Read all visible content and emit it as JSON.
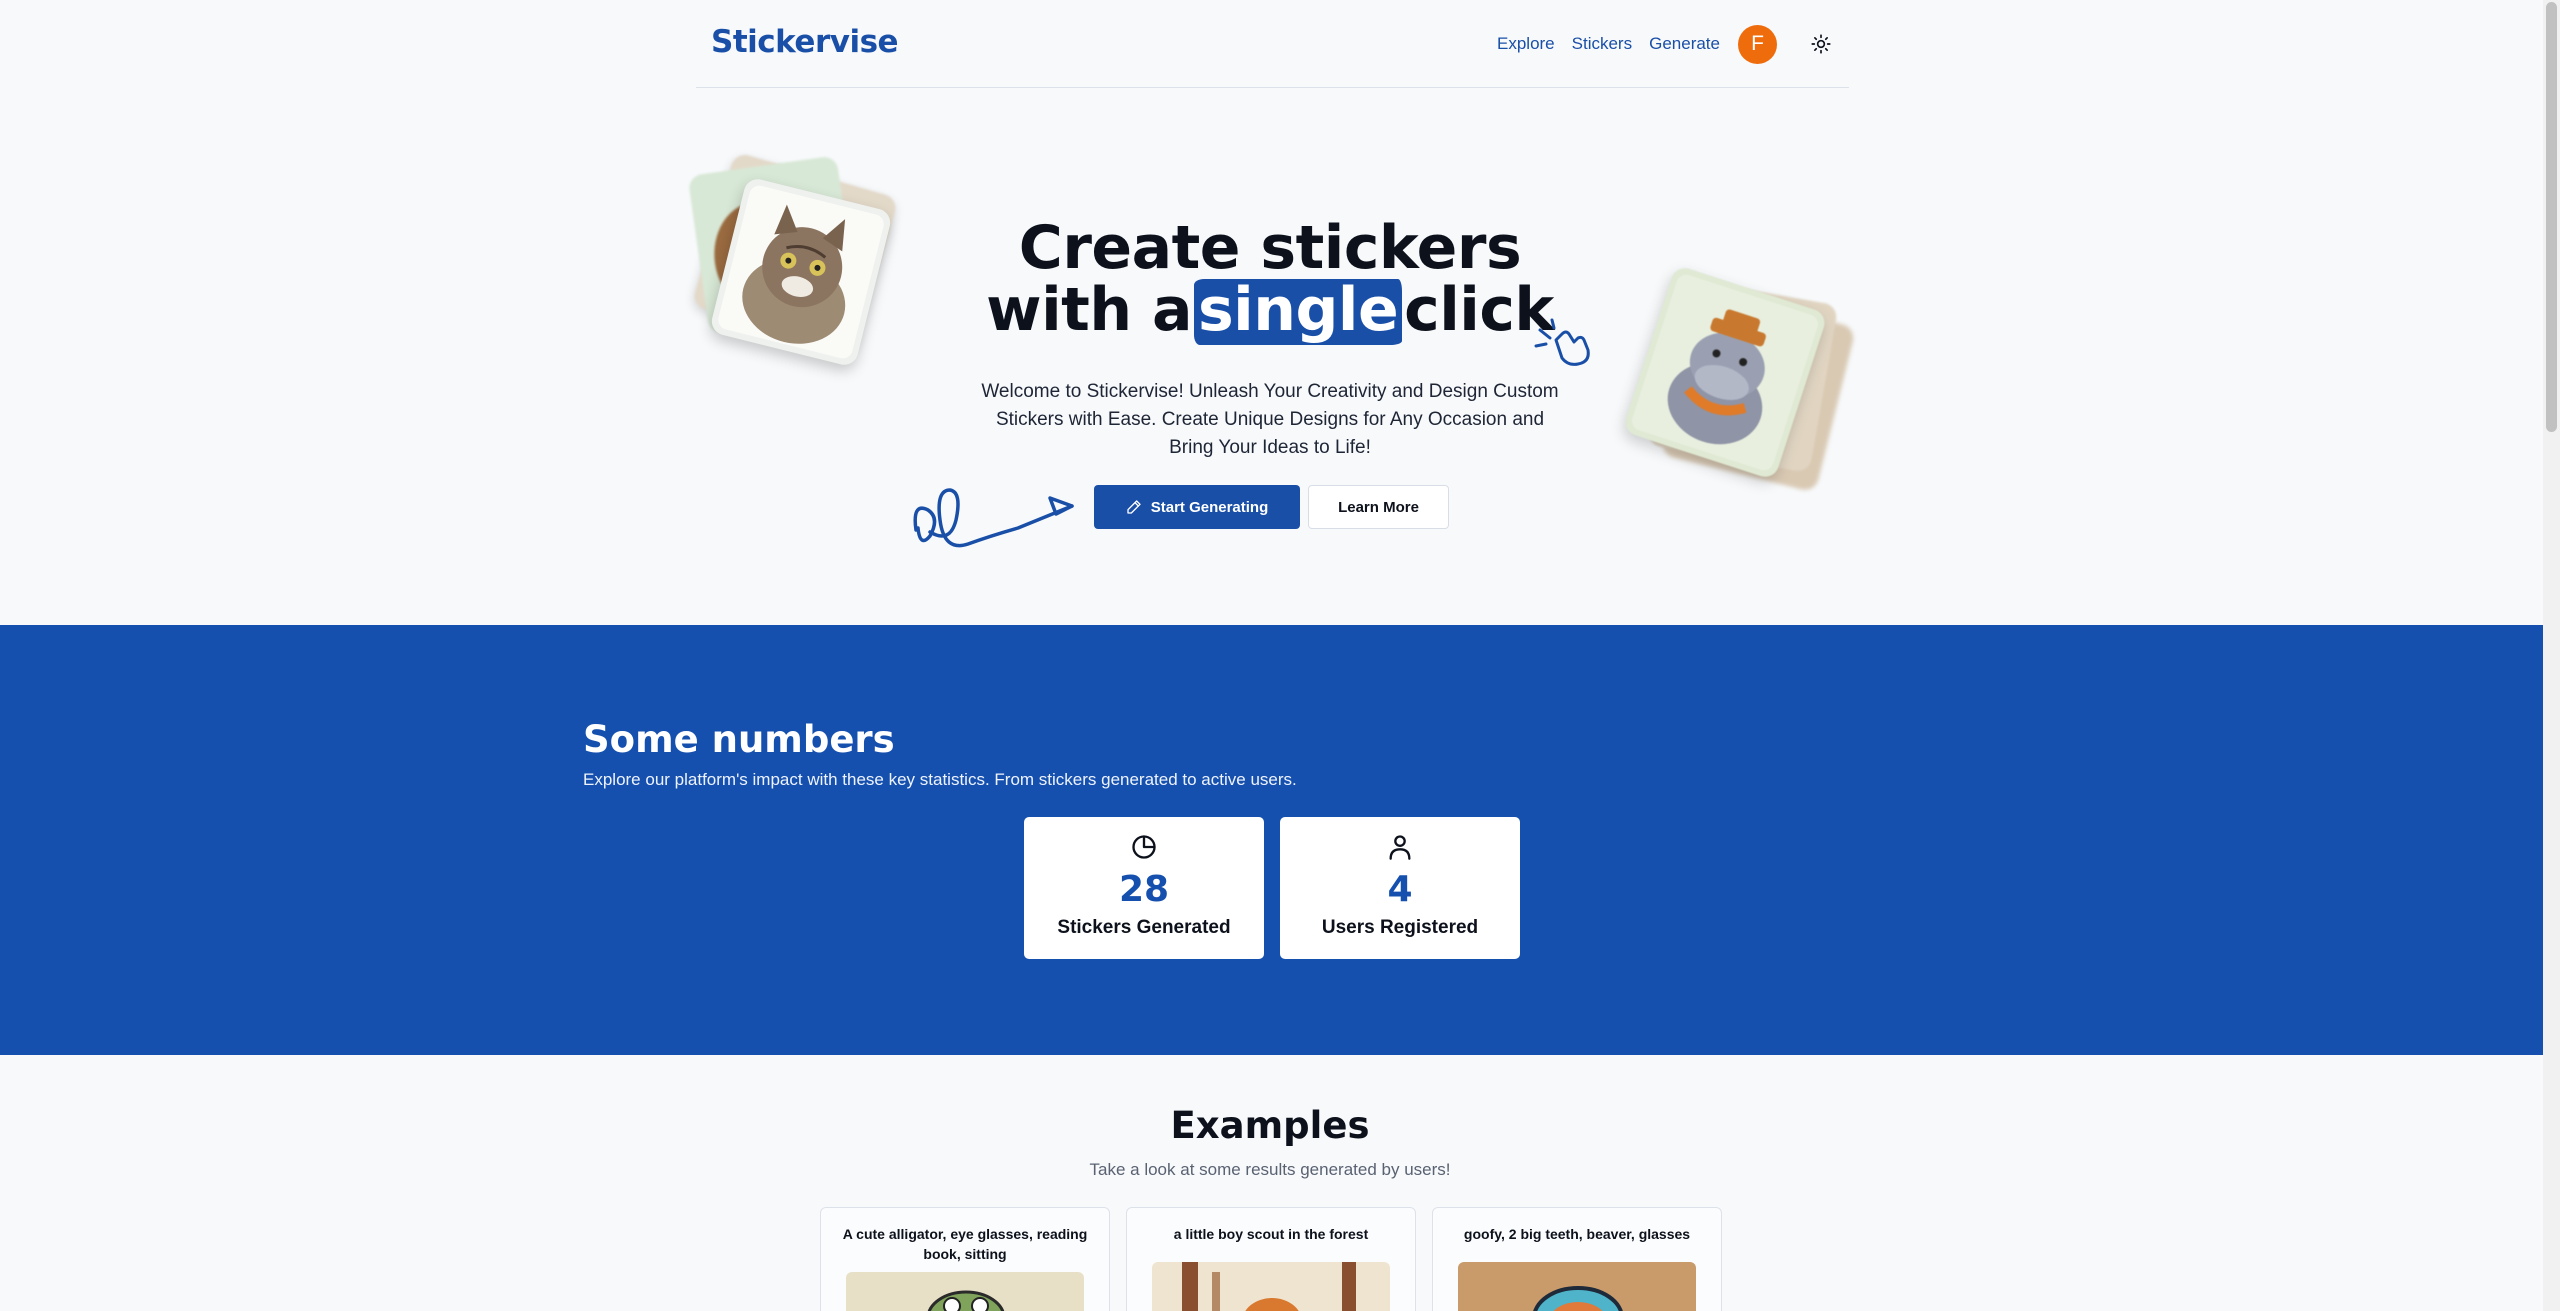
{
  "header": {
    "logo": "Stickervise",
    "nav": [
      "Explore",
      "Stickers",
      "Generate"
    ],
    "avatar_initial": "F"
  },
  "hero": {
    "title_line1": "Create stickers",
    "title_pre": "with a",
    "title_highlight": "single",
    "title_post": "click",
    "subtitle": "Welcome to Stickervise! Unleash Your Creativity and Design Custom Stickers with Ease. Create Unique Designs for Any Occasion and Bring Your Ideas to Life!",
    "primary_button": "Start Generating",
    "secondary_button": "Learn More"
  },
  "stats": {
    "title": "Some numbers",
    "subtitle": "Explore our platform's impact with these key statistics. From stickers generated to active users.",
    "cards": [
      {
        "value": "28",
        "label": "Stickers Generated",
        "icon": "pie-chart-icon"
      },
      {
        "value": "4",
        "label": "Users Registered",
        "icon": "user-icon"
      }
    ]
  },
  "examples": {
    "title": "Examples",
    "subtitle": "Take a look at some results generated by users!",
    "items": [
      {
        "caption": "A cute alligator, eye glasses, reading book, sitting"
      },
      {
        "caption": "a little boy scout in the forest"
      },
      {
        "caption": "goofy, 2 big teeth, beaver, glasses"
      }
    ]
  },
  "colors": {
    "brand": "#1a4fa8",
    "band": "#1550ae",
    "avatar": "#ef6c0d"
  }
}
